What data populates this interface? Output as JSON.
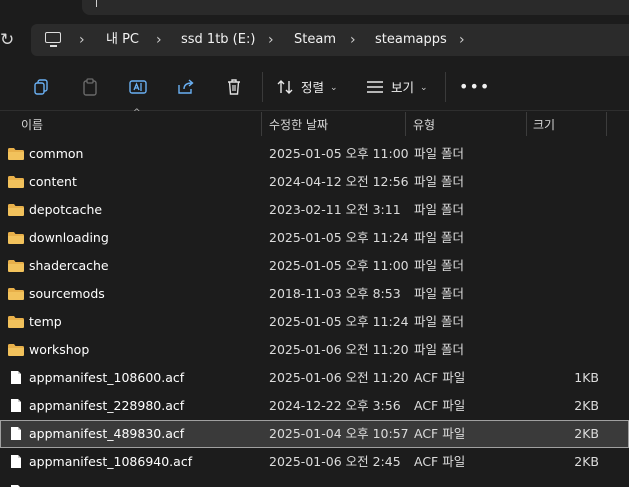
{
  "address": {
    "crumbs": [
      "내 PC",
      "ssd 1tb (E:)",
      "Steam",
      "steamapps"
    ]
  },
  "toolbar": {
    "sort_label": "정렬",
    "view_label": "보기",
    "more_label": "•••"
  },
  "columns": {
    "name": "이름",
    "date": "수정한 날짜",
    "type": "유형",
    "size": "크기"
  },
  "rows": [
    {
      "name": "common",
      "date": "2025-01-05 오후 11:00",
      "type": "파일 폴더",
      "size": "",
      "kind": "folder"
    },
    {
      "name": "content",
      "date": "2024-04-12 오전 12:56",
      "type": "파일 폴더",
      "size": "",
      "kind": "folder"
    },
    {
      "name": "depotcache",
      "date": "2023-02-11 오전 3:11",
      "type": "파일 폴더",
      "size": "",
      "kind": "folder"
    },
    {
      "name": "downloading",
      "date": "2025-01-05 오후 11:24",
      "type": "파일 폴더",
      "size": "",
      "kind": "folder"
    },
    {
      "name": "shadercache",
      "date": "2025-01-05 오후 11:00",
      "type": "파일 폴더",
      "size": "",
      "kind": "folder"
    },
    {
      "name": "sourcemods",
      "date": "2018-11-03 오후 8:53",
      "type": "파일 폴더",
      "size": "",
      "kind": "folder"
    },
    {
      "name": "temp",
      "date": "2025-01-05 오후 11:24",
      "type": "파일 폴더",
      "size": "",
      "kind": "folder"
    },
    {
      "name": "workshop",
      "date": "2025-01-06 오전 11:20",
      "type": "파일 폴더",
      "size": "",
      "kind": "folder"
    },
    {
      "name": "appmanifest_108600.acf",
      "date": "2025-01-06 오전 11:20",
      "type": "ACF 파일",
      "size": "1KB",
      "kind": "file"
    },
    {
      "name": "appmanifest_228980.acf",
      "date": "2024-12-22 오후 3:56",
      "type": "ACF 파일",
      "size": "2KB",
      "kind": "file"
    },
    {
      "name": "appmanifest_489830.acf",
      "date": "2025-01-04 오후 10:57",
      "type": "ACF 파일",
      "size": "2KB",
      "kind": "file",
      "selected": true
    },
    {
      "name": "appmanifest_1086940.acf",
      "date": "2025-01-06 오전 2:45",
      "type": "ACF 파일",
      "size": "2KB",
      "kind": "file"
    }
  ],
  "colors": {
    "background": "#1c1c1c",
    "folder": "#e8b04a",
    "selected_row": "#3a3a3a"
  },
  "icons": [
    "refresh-icon",
    "pc-icon",
    "copy-icon",
    "paste-icon",
    "rename-icon",
    "share-icon",
    "delete-icon",
    "sort-icon",
    "view-icon",
    "folder-icon",
    "file-icon"
  ]
}
